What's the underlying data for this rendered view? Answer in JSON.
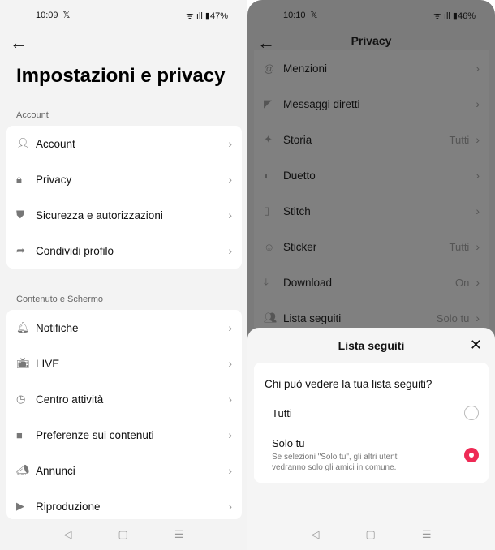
{
  "left": {
    "status": {
      "time": "10:09",
      "icons": "ᯤ ıll ▮",
      "battery": "47%"
    },
    "title": "Impostazioni e privacy",
    "sections": [
      {
        "label": "Account",
        "items": [
          {
            "label": "Account",
            "icon": "person-icon"
          },
          {
            "label": "Privacy",
            "icon": "lock-icon"
          },
          {
            "label": "Sicurezza e autorizzazioni",
            "icon": "shield-icon"
          },
          {
            "label": "Condividi profilo",
            "icon": "share-icon"
          }
        ]
      },
      {
        "label": "Contenuto e Schermo",
        "items": [
          {
            "label": "Notifiche",
            "icon": "bell-icon"
          },
          {
            "label": "LIVE",
            "icon": "tv-icon"
          },
          {
            "label": "Centro attività",
            "icon": "clock-icon"
          },
          {
            "label": "Preferenze sui contenuti",
            "icon": "video-icon"
          },
          {
            "label": "Annunci",
            "icon": "megaphone-icon"
          },
          {
            "label": "Riproduzione",
            "icon": "play-icon"
          }
        ]
      }
    ]
  },
  "right": {
    "status": {
      "time": "10:10",
      "icons": "ᯤ ıll ▮",
      "battery": "46%"
    },
    "title": "Privacy",
    "items": [
      {
        "label": "Menzioni",
        "value": "",
        "icon": "at-icon"
      },
      {
        "label": "Messaggi diretti",
        "value": "",
        "icon": "send-icon"
      },
      {
        "label": "Storia",
        "value": "Tutti",
        "icon": "sparkle-icon"
      },
      {
        "label": "Duetto",
        "value": "",
        "icon": "duet-icon"
      },
      {
        "label": "Stitch",
        "value": "",
        "icon": "stitch-icon"
      },
      {
        "label": "Sticker",
        "value": "Tutti",
        "icon": "sticker-icon"
      },
      {
        "label": "Download",
        "value": "On",
        "icon": "download-icon"
      },
      {
        "label": "Lista seguiti",
        "value": "Solo tu",
        "icon": "people-icon"
      }
    ],
    "sheet": {
      "title": "Lista seguiti",
      "question": "Chi può vedere la tua lista seguiti?",
      "options": [
        {
          "label": "Tutti",
          "description": "",
          "selected": false
        },
        {
          "label": "Solo tu",
          "description": "Se selezioni \"Solo tu\", gli altri utenti vedranno solo gli amici in comune.",
          "selected": true
        }
      ],
      "accent": "#ee2a55"
    }
  },
  "nav": {
    "back": "◁",
    "home": "▢",
    "menu": "☰"
  }
}
